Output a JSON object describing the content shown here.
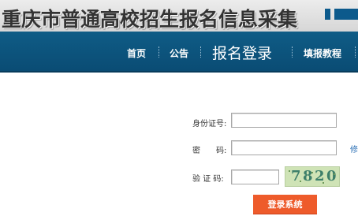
{
  "header": {
    "title": "重庆市普通高校招生报名信息采集"
  },
  "nav": {
    "home": "首页",
    "notice": "公告",
    "login": "报名登录",
    "tutorial": "填报教程"
  },
  "form": {
    "id_label": "身份证号",
    "password_label": "密　　码",
    "captcha_label": "验 证 码",
    "colon": ":",
    "id_value": "",
    "password_value": "",
    "captcha_value": "",
    "captcha_image_text": [
      "7",
      "8",
      "2",
      "0"
    ],
    "side_hint": "修",
    "submit_label": "登录系统"
  },
  "colors": {
    "navbar": "#0a4c74",
    "button": "#ee5b2b",
    "captcha_bg": "#cfe3b6"
  }
}
